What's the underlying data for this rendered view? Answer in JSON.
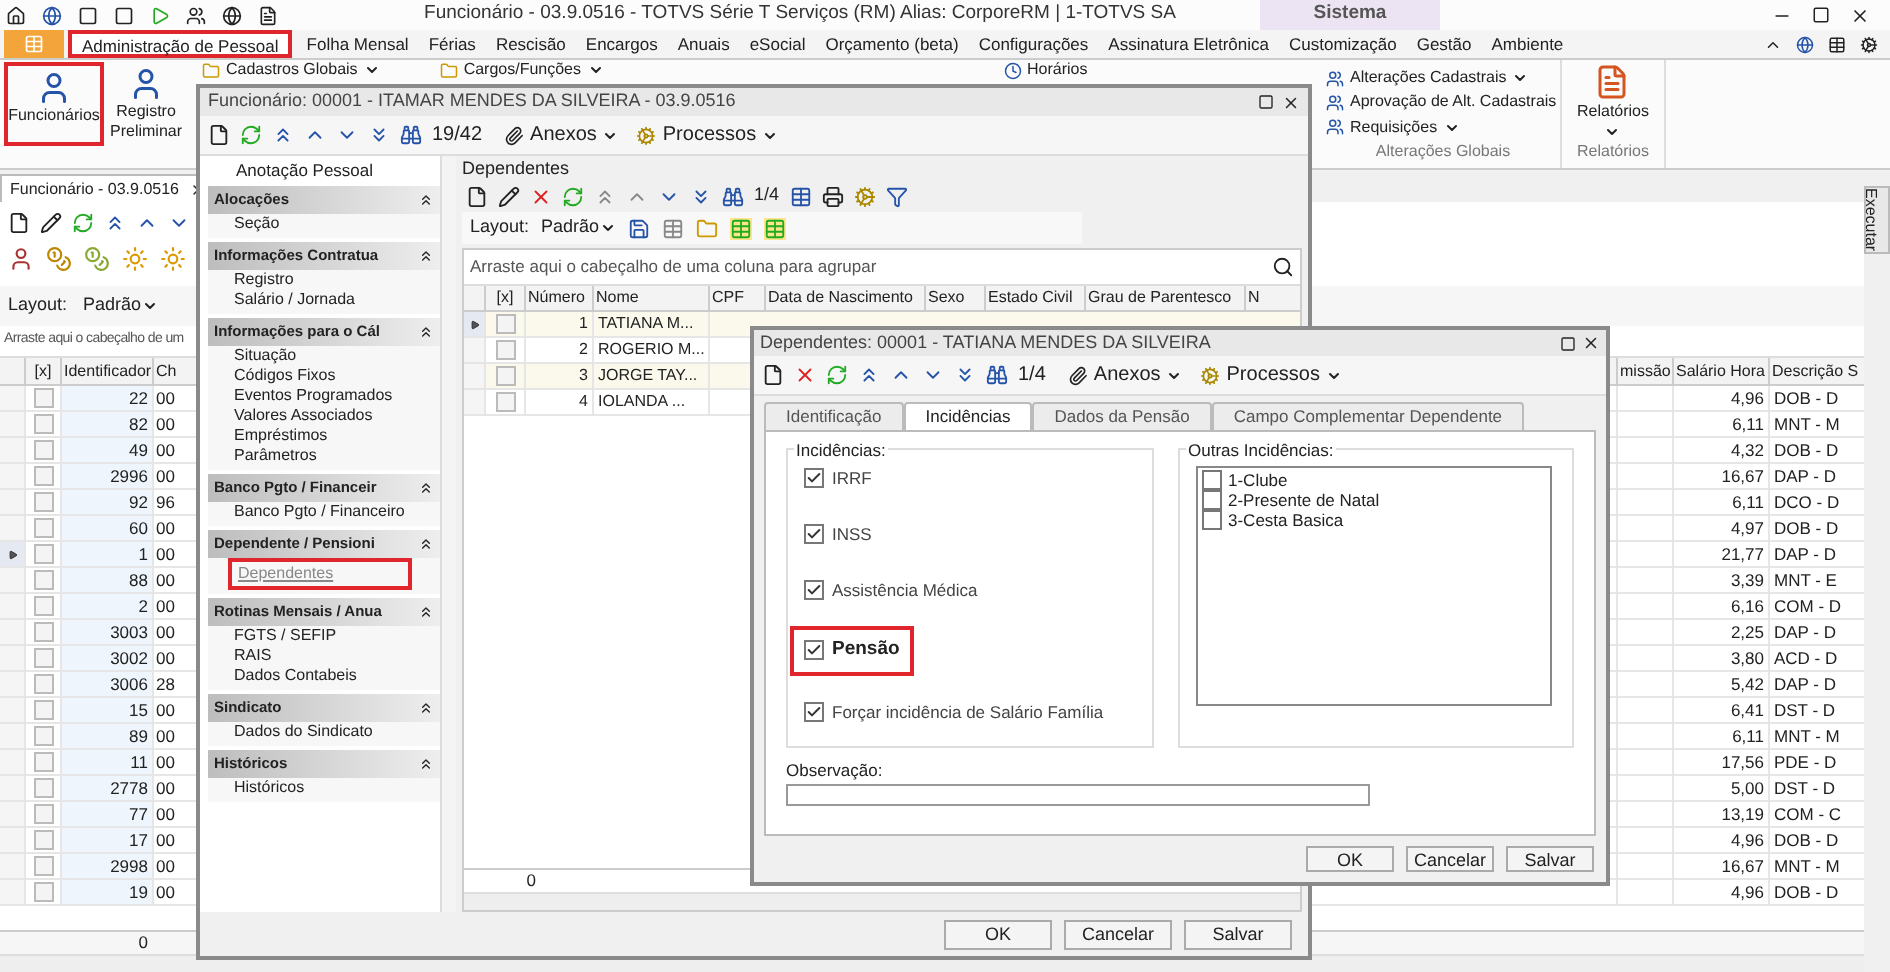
{
  "title_bar": {
    "title": "Funcionário - 03.9.0516 - TOTVS Série T Serviços (RM) Alias: CorporeRM | 1-TOTVS SA",
    "context_tab": "Sistema"
  },
  "menu_tabs": [
    {
      "label": "Administração de Pessoal",
      "selected": true
    },
    {
      "label": "Folha Mensal",
      "selected": false
    },
    {
      "label": "Férias",
      "selected": false
    },
    {
      "label": "Rescisão",
      "selected": false
    },
    {
      "label": "Encargos",
      "selected": false
    },
    {
      "label": "Anuais",
      "selected": false
    },
    {
      "label": "eSocial",
      "selected": false
    },
    {
      "label": "Orçamento (beta)",
      "selected": false
    },
    {
      "label": "Configurações",
      "selected": false
    },
    {
      "label": "Assinatura Eletrônica",
      "selected": false
    },
    {
      "label": "Customização",
      "selected": false
    },
    {
      "label": "Gestão",
      "selected": false
    },
    {
      "label": "Ambiente",
      "selected": false
    }
  ],
  "ribbon": {
    "large_buttons": [
      {
        "label": "Funcionários",
        "highlighted": true
      },
      {
        "label": "Registro Preliminar",
        "highlighted": false
      }
    ],
    "partial_items": [
      "Cadastros Globais",
      "Cargos/Funções",
      "Horários"
    ],
    "groups": [
      {
        "kind": "list",
        "label": "Alterações Globais",
        "items": [
          {
            "label": "Alterações Cadastrais",
            "dropdown": true
          },
          {
            "label": "Aprovação de Alt. Cadastrais",
            "dropdown": false
          },
          {
            "label": "Requisições",
            "dropdown": true
          }
        ]
      },
      {
        "kind": "large",
        "label": "Relatórios",
        "button": "Relatórios"
      }
    ]
  },
  "document_tab": {
    "label": "Funcionário - 03.9.0516"
  },
  "side_tab": {
    "label": "Executar"
  },
  "main_grid": {
    "layout_label": "Layout:",
    "layout_value": "Padrão",
    "group_hint": "Arraste aqui o cabeçalho de um",
    "columns": [
      "[x]",
      "Identificador",
      "Ch"
    ],
    "right_columns": [
      "missão",
      "Salário Hora",
      "Descrição S"
    ],
    "footer": "0",
    "rows": [
      {
        "id": "22",
        "col_3": "00",
        "salary": "4,96",
        "description": "DOB - D",
        "checked": false,
        "selected": false
      },
      {
        "id": "82",
        "col_3": "00",
        "salary": "6,11",
        "description": "MNT - M",
        "checked": false,
        "selected": false
      },
      {
        "id": "49",
        "col_3": "00",
        "salary": "4,32",
        "description": "DOB - D",
        "checked": false,
        "selected": false
      },
      {
        "id": "2996",
        "col_3": "00",
        "salary": "16,67",
        "description": "DAP - D",
        "checked": false,
        "selected": false
      },
      {
        "id": "92",
        "col_3": "96",
        "salary": "6,11",
        "description": "DCO - D",
        "checked": false,
        "selected": false
      },
      {
        "id": "60",
        "col_3": "00",
        "salary": "4,97",
        "description": "DOB - D",
        "checked": false,
        "selected": false
      },
      {
        "id": "1",
        "col_3": "00",
        "salary": "21,77",
        "description": "DAP - D",
        "checked": false,
        "selected": true
      },
      {
        "id": "88",
        "col_3": "00",
        "salary": "3,39",
        "description": "MNT - E",
        "checked": false,
        "selected": false
      },
      {
        "id": "2",
        "col_3": "00",
        "salary": "6,16",
        "description": "COM - D",
        "checked": false,
        "selected": false
      },
      {
        "id": "3003",
        "col_3": "00",
        "salary": "2,25",
        "description": "DAP - D",
        "checked": false,
        "selected": false
      },
      {
        "id": "3002",
        "col_3": "00",
        "salary": "3,80",
        "description": "ACD - D",
        "checked": false,
        "selected": false
      },
      {
        "id": "3006",
        "col_3": "28",
        "salary": "5,42",
        "description": "DAP - D",
        "checked": false,
        "selected": false
      },
      {
        "id": "15",
        "col_3": "00",
        "salary": "6,41",
        "description": "DST - D",
        "checked": false,
        "selected": false
      },
      {
        "id": "89",
        "col_3": "00",
        "salary": "6,11",
        "description": "MNT - M",
        "checked": false,
        "selected": false
      },
      {
        "id": "11",
        "col_3": "00",
        "salary": "17,56",
        "description": "PDE - D",
        "checked": false,
        "selected": false
      },
      {
        "id": "2778",
        "col_3": "00",
        "salary": "5,00",
        "description": "DST - D",
        "checked": false,
        "selected": false
      },
      {
        "id": "77",
        "col_3": "00",
        "salary": "13,19",
        "description": "COM - C",
        "checked": false,
        "selected": false
      },
      {
        "id": "17",
        "col_3": "00",
        "salary": "4,96",
        "description": "DOB - D",
        "checked": false,
        "selected": false
      },
      {
        "id": "2998",
        "col_3": "00",
        "salary": "16,67",
        "description": "MNT - M",
        "checked": false,
        "selected": false
      },
      {
        "id": "19",
        "col_3": "00",
        "salary": "4,96",
        "description": "DOB - D",
        "checked": false,
        "selected": false
      }
    ]
  },
  "employee_dialog": {
    "title": "Funcionário: 00001 - ITAMAR MENDES DA SILVEIRA - 03.9.0516",
    "counter": "19/42",
    "attachments": "Anexos",
    "processes": "Processos",
    "nav_top_item": "Anotação Pessoal",
    "nav_sections": [
      {
        "title": "Alocações",
        "items": [
          {
            "label": "Seção",
            "highlighted": false
          }
        ]
      },
      {
        "title": "Informações Contratua",
        "items": [
          {
            "label": "Registro",
            "highlighted": false
          },
          {
            "label": "Salário / Jornada",
            "highlighted": false
          }
        ]
      },
      {
        "title": "Informações para o Cál",
        "items": [
          {
            "label": "Situação",
            "highlighted": false
          },
          {
            "label": "Códigos Fixos",
            "highlighted": false
          },
          {
            "label": "Eventos Programados",
            "highlighted": false
          },
          {
            "label": "Valores Associados",
            "highlighted": false
          },
          {
            "label": "Empréstimos",
            "highlighted": false
          },
          {
            "label": "Parâmetros",
            "highlighted": false
          }
        ]
      },
      {
        "title": "Banco Pgto / Financeir",
        "items": [
          {
            "label": "Banco Pgto / Financeiro",
            "highlighted": false
          }
        ]
      },
      {
        "title": "Dependente / Pensioni",
        "items": [
          {
            "label": "Dependentes",
            "highlighted": true
          }
        ]
      },
      {
        "title": "Rotinas Mensais / Anua",
        "items": [
          {
            "label": "FGTS / SEFIP",
            "highlighted": false
          },
          {
            "label": "RAIS",
            "highlighted": false
          },
          {
            "label": "Dados Contabeis",
            "highlighted": false
          }
        ]
      },
      {
        "title": "Sindicato",
        "items": [
          {
            "label": "Dados do Sindicato",
            "highlighted": false
          }
        ]
      },
      {
        "title": "Históricos",
        "items": [
          {
            "label": "Históricos",
            "highlighted": false
          }
        ]
      }
    ],
    "dependents": {
      "label": "Dependentes",
      "counter": "1/4",
      "layout_label": "Layout:",
      "layout_value": "Padrão",
      "group_hint": "Arraste aqui o cabeçalho de uma coluna para agrupar",
      "columns": [
        "[x]",
        "Número",
        "Nome",
        "CPF",
        "Data de Nascimento",
        "Sexo",
        "Estado Civil",
        "Grau de Parentesco",
        "N"
      ],
      "footer": "0",
      "rows": [
        {
          "number": "1",
          "name": "TATIANA M...",
          "checked": false,
          "selected": true
        },
        {
          "number": "2",
          "name": "ROGERIO M...",
          "checked": false,
          "selected": false
        },
        {
          "number": "3",
          "name": "JORGE TAY...",
          "checked": false,
          "selected": false
        },
        {
          "number": "4",
          "name": "IOLANDA ...",
          "checked": false,
          "selected": false
        }
      ]
    },
    "buttons": [
      "OK",
      "Cancelar",
      "Salvar"
    ]
  },
  "dependent_dialog": {
    "title": "Dependentes: 00001 - TATIANA MENDES DA SILVEIRA",
    "counter": "1/4",
    "attachments": "Anexos",
    "processes": "Processos",
    "tabs": [
      {
        "label": "Identificação",
        "selected": false
      },
      {
        "label": "Incidências",
        "selected": true
      },
      {
        "label": "Dados da Pensão",
        "selected": false
      },
      {
        "label": "Campo Complementar Dependente",
        "selected": false
      }
    ],
    "incidences": {
      "label": "Incidências:",
      "items": [
        {
          "label": "IRRF",
          "checked": true,
          "emphasized": false
        },
        {
          "label": "INSS",
          "checked": true,
          "emphasized": false
        },
        {
          "label": "Assistência Médica",
          "checked": true,
          "emphasized": false
        },
        {
          "label": "Pensão",
          "checked": true,
          "emphasized": true
        },
        {
          "label": "Forçar incidência de Salário Família",
          "checked": true,
          "emphasized": false
        }
      ]
    },
    "other_incidences": {
      "label": "Outras Incidências:",
      "items": [
        {
          "label": "1-Clube",
          "checked": false
        },
        {
          "label": "2-Presente de Natal",
          "checked": false
        },
        {
          "label": "3-Cesta Basica",
          "checked": false
        }
      ]
    },
    "observation": {
      "label": "Observação:"
    },
    "buttons": [
      "OK",
      "Cancelar",
      "Salvar"
    ]
  }
}
